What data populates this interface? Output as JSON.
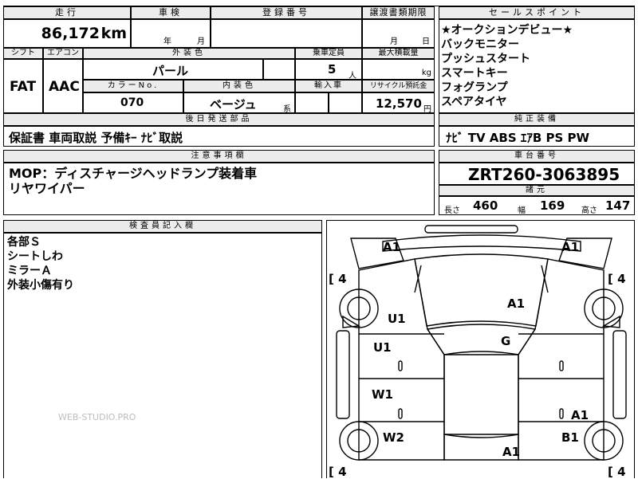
{
  "header_row": {
    "mileage_label": "走行",
    "inspection_label": "車検",
    "registration_label": "登録番号",
    "transfer_deadline_label": "譲渡書類期限",
    "selling_points_label": "セールスポイント"
  },
  "mileage": {
    "value": "86,172",
    "unit": "km"
  },
  "inspection": {
    "year_unit": "年",
    "month_unit": "月"
  },
  "transfer": {
    "month_unit": "月",
    "day_unit": "日"
  },
  "selling_points": [
    "★オークションデビュー★",
    "バックモニター",
    "プッシュスタート",
    "スマートキー",
    "フォグランプ",
    "スペアタイヤ"
  ],
  "row2_labels": {
    "shift": "シフト",
    "aircon": "エアコン",
    "exterior_color": "外装色",
    "capacity": "乗車定員",
    "max_load": "最大積載量"
  },
  "shift": "FAT",
  "aircon": "AAC",
  "exterior_color": "パール",
  "capacity": {
    "value": "5",
    "unit": "人"
  },
  "max_load_unit": "kg",
  "row3_labels": {
    "color_no": "カラーNo.",
    "interior_color": "内装色",
    "import": "輸入車",
    "recycle": "リサイクル預託金"
  },
  "color_no": "070",
  "interior": {
    "value": "ベージュ",
    "suffix": "系"
  },
  "recycle": {
    "value": "12,570",
    "unit": "円"
  },
  "documents_label": "後日発送部品",
  "documents": "保証書 車両取説 予備ｷｰ ﾅﾋﾞ取説",
  "equipment_label": "純正装備",
  "equipment": "ﾅﾋﾞ TV ABS ｴｱB PS PW",
  "notes_label": "注意事項欄",
  "notes": [
    "MOP：ディスチャージヘッドランプ装着車",
    "リヤワイパー"
  ],
  "chassis_label": "車台番号",
  "chassis_number": "ZRT260-3063895",
  "specs_label": "諸元",
  "specs": {
    "length_label": "長さ",
    "length": "460",
    "width_label": "幅",
    "width": "169",
    "height_label": "高さ",
    "height": "147"
  },
  "inspector_label": "検査員記入欄",
  "inspector_notes": [
    "各部Ｓ",
    "シートしわ",
    "ミラーＡ",
    "外装小傷有り"
  ],
  "watermark": "WEB-STUDIO.PRO",
  "diagram": {
    "front_left_corner": "A1",
    "front_right_corner": "A1",
    "hood": "A1",
    "windshield": "G",
    "left_front_fender": "U1",
    "left_front_door": "U1",
    "left_rear_door": "W1",
    "left_rear_fender": "W2",
    "right_rear_door": "A1",
    "right_rear_fender": "B1",
    "roof_rear": "A1",
    "tire_fl": "[ 4",
    "tire_fr": "[ 4",
    "tire_rl": "[ 4",
    "tire_rr": "[ 4"
  }
}
